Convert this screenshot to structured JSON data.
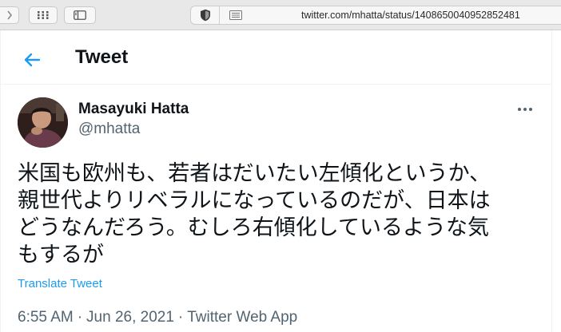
{
  "browser": {
    "url": "twitter.com/mhatta/status/1408650040952852481",
    "icons": [
      "chevron-right-icon",
      "grid-icon",
      "sidebar-icon",
      "shield-icon",
      "reader-icon"
    ]
  },
  "header": {
    "title": "Tweet",
    "back_icon": "arrow-left-icon"
  },
  "tweet": {
    "author": {
      "name": "Masayuki Hatta",
      "handle": "@mhatta"
    },
    "text_lines": [
      "米国も欧州も、若者はだいたい左傾化というか、",
      "親世代よりリベラルになっているのだが、日本は",
      "どうなんだろう。むしろ右傾化しているような気",
      "もするが"
    ],
    "translate_label": "Translate Tweet",
    "time": "6:55 AM",
    "separator": "·",
    "date": "Jun 26, 2021",
    "source": "Twitter Web App"
  },
  "colors": {
    "accent": "#1d9bf0",
    "text_primary": "#0f1419",
    "text_secondary": "#536471"
  }
}
